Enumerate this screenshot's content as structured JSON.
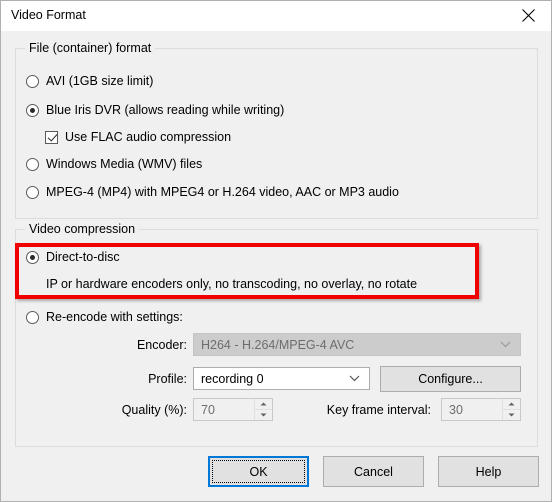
{
  "window": {
    "title": "Video Format",
    "close_icon": "close-icon"
  },
  "container_group": {
    "title": "File (container) format",
    "options": [
      {
        "label": "AVI (1GB size limit)",
        "selected": false
      },
      {
        "label": "Blue Iris DVR (allows reading while writing)",
        "selected": true
      },
      {
        "label": "Windows Media (WMV) files",
        "selected": false
      },
      {
        "label": "MPEG-4 (MP4) with MPEG4 or H.264 video, AAC or MP3 audio",
        "selected": false
      }
    ],
    "flac_checkbox": {
      "label": "Use FLAC audio compression",
      "checked": true
    }
  },
  "compression_group": {
    "title": "Video compression",
    "direct_to_disc": {
      "label": "Direct-to-disc",
      "selected": true,
      "description": "IP or hardware encoders only, no transcoding, no overlay, no rotate",
      "highlight_color": "#f00000"
    },
    "reencode": {
      "label": "Re-encode with settings:",
      "selected": false
    },
    "encoder": {
      "label": "Encoder:",
      "value": "H264 - H.264/MPEG-4 AVC",
      "disabled": true,
      "arrow_icon": "chevron-down-icon"
    },
    "profile": {
      "label": "Profile:",
      "value": "recording 0",
      "disabled": false,
      "arrow_icon": "chevron-down-icon"
    },
    "configure_button": {
      "label": "Configure..."
    },
    "quality": {
      "label": "Quality (%):",
      "value": "70",
      "disabled": true
    },
    "key_frame_interval": {
      "label": "Key frame interval:",
      "value": "30",
      "disabled": true
    }
  },
  "footer": {
    "ok_button": "OK",
    "cancel_button": "Cancel",
    "help_button": "Help"
  }
}
